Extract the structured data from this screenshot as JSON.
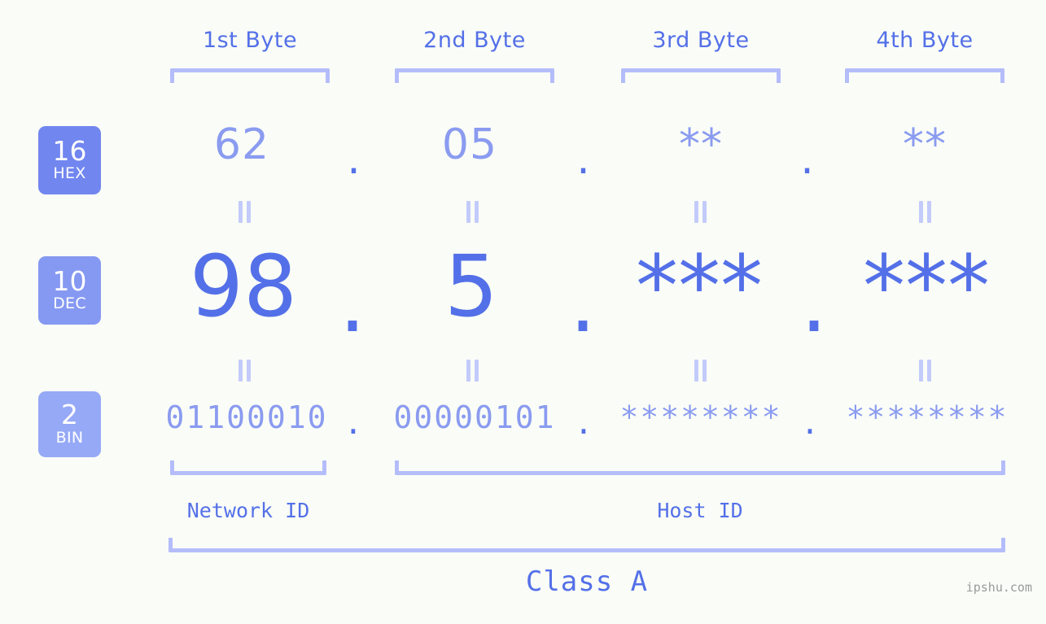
{
  "meta": {
    "background_color": "#fafdf7",
    "accent_strong": "#5470e8",
    "accent_light": "#8a9bf0",
    "bracket_color": "#b4bdfa",
    "watermark": "ipshu.com"
  },
  "byte_headers": [
    {
      "label": "1st Byte"
    },
    {
      "label": "2nd Byte"
    },
    {
      "label": "3rd Byte"
    },
    {
      "label": "4th Byte"
    }
  ],
  "rows": [
    {
      "id": "hex",
      "badge_number": "16",
      "badge_system": "HEX",
      "badge_color": "#7186ef",
      "values": [
        "62",
        "05",
        "**",
        "**"
      ],
      "separators": [
        ".",
        ".",
        "."
      ]
    },
    {
      "id": "dec",
      "badge_number": "10",
      "badge_system": "DEC",
      "badge_color": "#8599f2",
      "values": [
        "98",
        "5",
        "***",
        "***"
      ],
      "separators": [
        ".",
        ".",
        "."
      ]
    },
    {
      "id": "bin",
      "badge_number": "2",
      "badge_system": "BIN",
      "badge_color": "#96a9f6",
      "values": [
        "01100010",
        "00000101",
        "********",
        "********"
      ],
      "separators": [
        ".",
        ".",
        "."
      ]
    }
  ],
  "equals_symbol": "=",
  "sections": [
    {
      "label": "Network ID"
    },
    {
      "label": "Host ID"
    }
  ],
  "address_class": {
    "label": "Class A"
  }
}
